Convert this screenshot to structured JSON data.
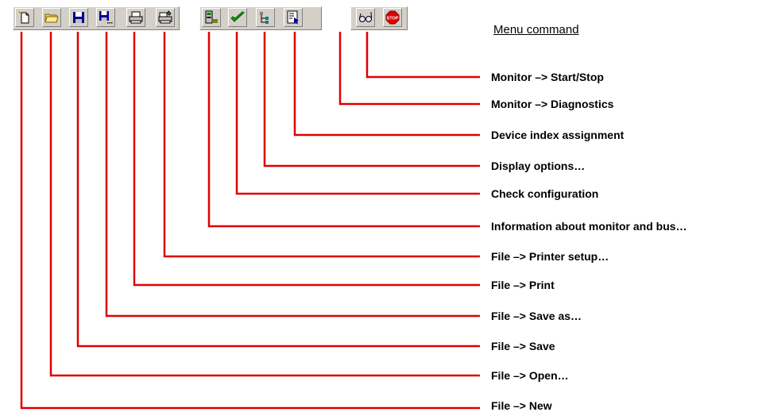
{
  "header": {
    "menu_command_label": "Menu command"
  },
  "toolbar": {
    "buttons": [
      {
        "name": "new-button",
        "icon": "new-file-icon"
      },
      {
        "name": "open-button",
        "icon": "open-folder-icon"
      },
      {
        "name": "save-button",
        "icon": "floppy-disk-icon"
      },
      {
        "name": "save-as-button",
        "icon": "floppy-disk-ellipsis-icon"
      },
      {
        "name": "print-button",
        "icon": "printer-icon"
      },
      {
        "name": "printer-setup-button",
        "icon": "printer-setup-icon"
      },
      {
        "name": "monitor-info-button",
        "icon": "monitor-info-icon"
      },
      {
        "name": "check-configuration-button",
        "icon": "checkmark-icon"
      },
      {
        "name": "display-options-button",
        "icon": "tree-view-icon"
      },
      {
        "name": "device-index-button",
        "icon": "device-index-icon"
      },
      {
        "name": "diagnostics-button",
        "icon": "glasses-icon"
      },
      {
        "name": "start-stop-button",
        "icon": "stop-sign-icon"
      }
    ],
    "stop_icon_text": "STOP"
  },
  "callouts": [
    "Monitor –> Start/Stop",
    "Monitor –> Diagnostics",
    "Device index assignment",
    "Display options…",
    "Check configuration",
    "Information about monitor and bus…",
    "File –> Printer setup…",
    "File –> Print",
    "File –> Save as…",
    "File –> Save",
    "File –> Open…",
    "File –> New"
  ],
  "colors": {
    "line": "#dd0000",
    "toolbar_face": "#d4d0c8"
  }
}
